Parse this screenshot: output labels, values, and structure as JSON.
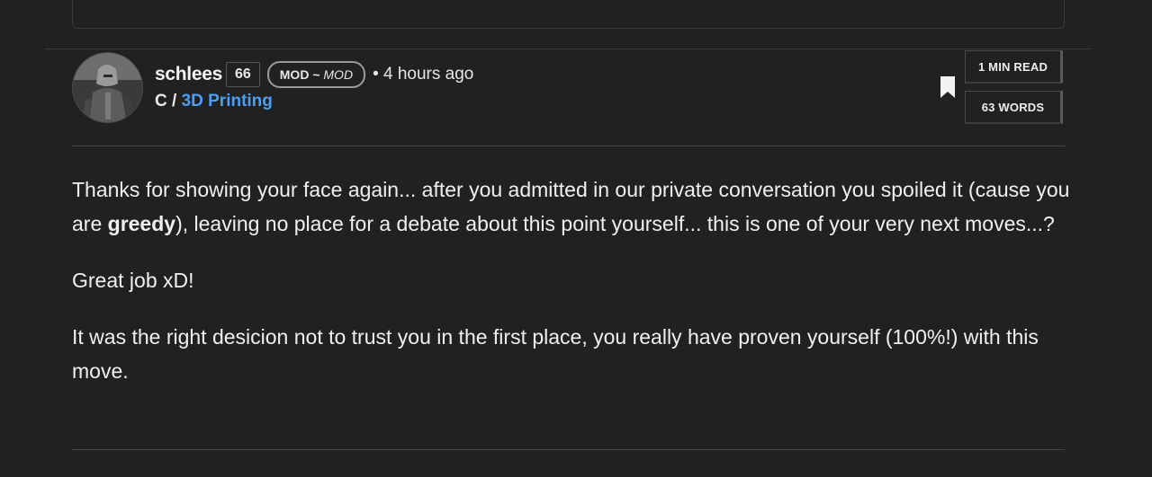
{
  "post": {
    "author": "schlees",
    "reputation": "66",
    "role_badge": {
      "main": "MOD ~ ",
      "sub": "MOD"
    },
    "timestamp": "• 4 hours ago",
    "community_prefix": "C / ",
    "community_name": "3D Printing",
    "stats": {
      "read_time": "1 MIN READ",
      "word_count": "63 WORDS"
    },
    "body": {
      "p1_before": "Thanks for showing your face again... after you admitted in our private conversation you spoiled it (cause you are ",
      "p1_bold": "greedy",
      "p1_after": "), leaving no place for a debate about this point yourself... this is one of your very next moves...?",
      "p2": "Great job xD!",
      "p3": "It was the right desicion not to trust you in the first place, you really have proven yourself (100%!) with this move."
    }
  },
  "icons": {
    "avatar": "avatar-image",
    "bookmark": "bookmark-icon"
  },
  "colors": {
    "background": "#212121",
    "link": "#4e9ff2",
    "divider": "#444444"
  }
}
